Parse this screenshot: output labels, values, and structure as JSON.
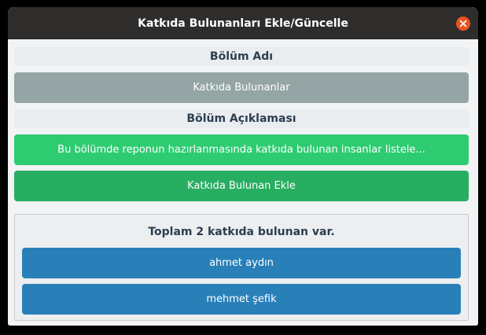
{
  "window": {
    "title": "Katkıda Bulunanları Ekle/Güncelle"
  },
  "form": {
    "section_name_label": "Bölüm Adı",
    "section_name_value": "Katkıda Bulunanlar",
    "section_desc_label": "Bölüm Açıklaması",
    "section_desc_value": "Bu bölümde reponun hazırlanmasında katkıda bulunan insanlar listele...",
    "add_contributor_label": "Katkıda Bulunan Ekle"
  },
  "contributors": {
    "summary": "Toplam 2 katkıda bulunan var.",
    "items": [
      {
        "name": "ahmet aydın"
      },
      {
        "name": "mehmet şefik"
      }
    ]
  },
  "colors": {
    "titlebar": "#2e2d2c",
    "close": "#e95420",
    "gray_button": "#95a5a6",
    "light_green_button": "#2ecc71",
    "green_button": "#27ae60",
    "blue_button": "#2980b9",
    "text_dark": "#2c3e50"
  },
  "icons": {
    "close": "close-icon"
  }
}
